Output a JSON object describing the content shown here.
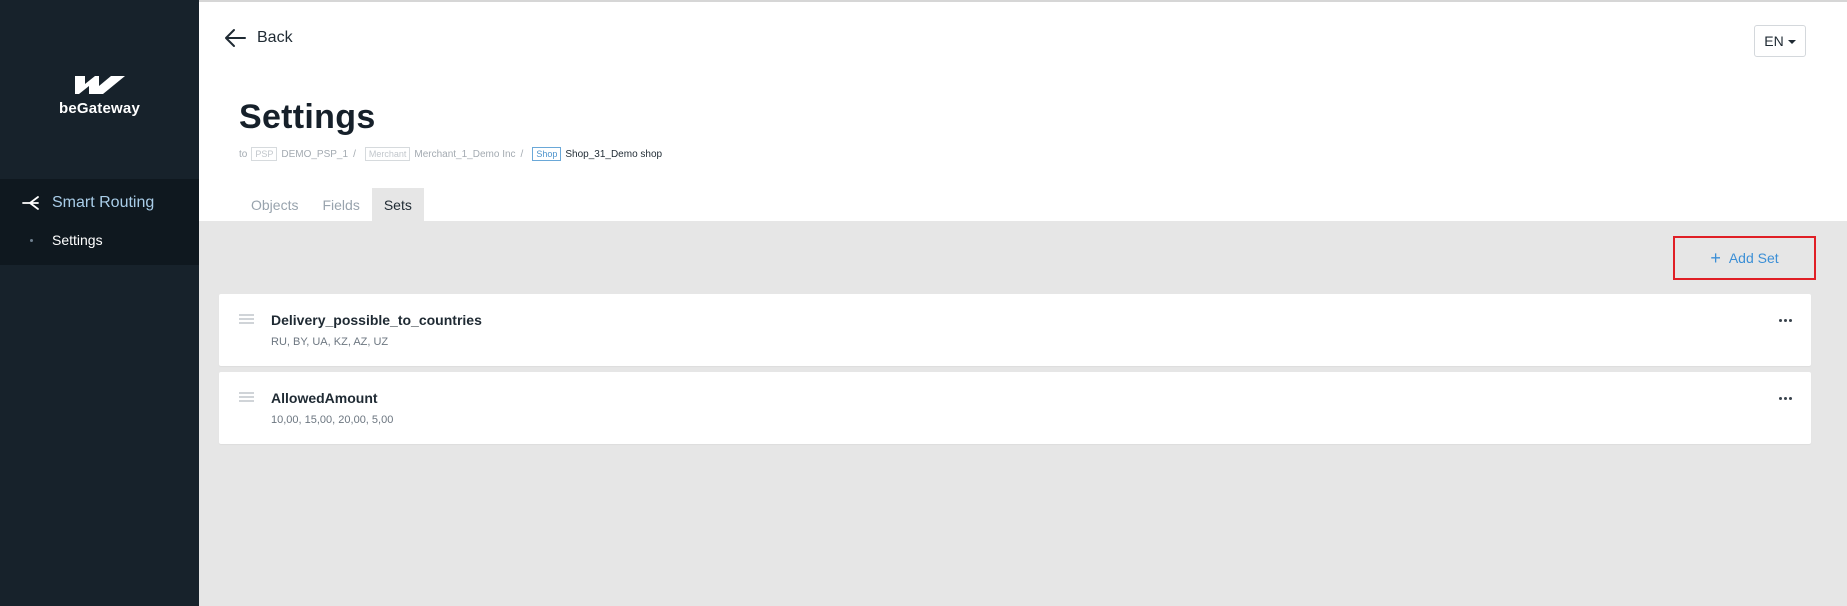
{
  "app": {
    "logo_text": "beGateway"
  },
  "sidebar": {
    "section_label": "Smart Routing",
    "section_icon": "routing-icon",
    "items": [
      {
        "label": "Settings"
      }
    ]
  },
  "header": {
    "back_label": "Back",
    "language": "EN"
  },
  "page": {
    "title": "Settings",
    "breadcrumb": {
      "prefix": "to",
      "items": [
        {
          "tag": "PSP",
          "value": "DEMO_PSP_1"
        },
        {
          "tag": "Merchant",
          "value": "Merchant_1_Demo Inc"
        },
        {
          "tag": "Shop",
          "value": "Shop_31_Demo shop"
        }
      ],
      "separator": "/"
    }
  },
  "tabs": [
    {
      "label": "Objects"
    },
    {
      "label": "Fields"
    },
    {
      "label": "Sets",
      "active": true
    }
  ],
  "toolbar": {
    "add_label": "Add Set"
  },
  "sets": [
    {
      "name": "Delivery_possible_to_countries",
      "values": "RU, BY, UA, KZ, AZ, UZ"
    },
    {
      "name": "AllowedAmount",
      "values": "10,00, 15,00, 20,00, 5,00"
    }
  ],
  "colors": {
    "sidebar_bg": "#17222b",
    "accent": "#3c8fd6",
    "highlight_border": "#e01f26",
    "content_bg": "#e6e6e6"
  }
}
